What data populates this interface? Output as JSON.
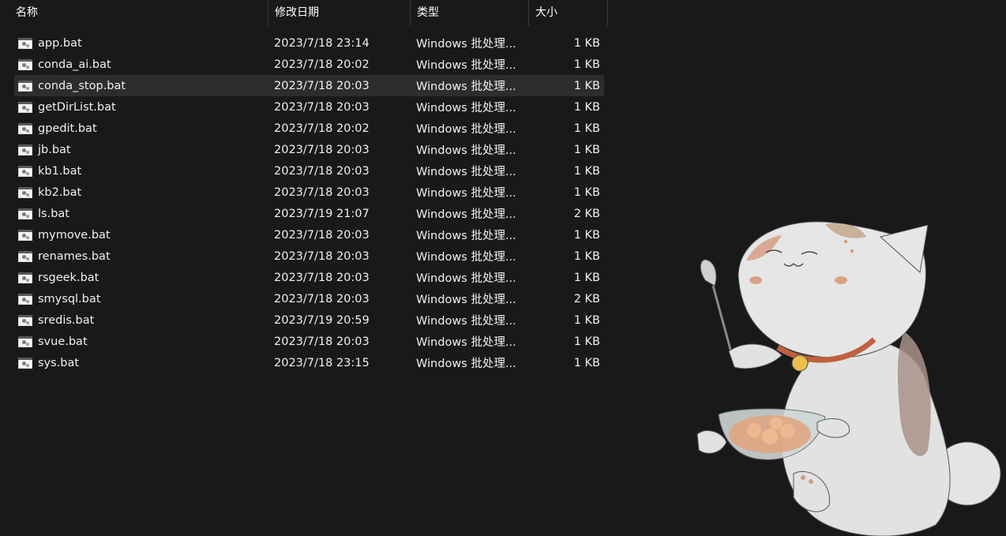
{
  "columns": {
    "name": "名称",
    "date": "修改日期",
    "type": "类型",
    "size": "大小"
  },
  "files": [
    {
      "name": "app.bat",
      "date": "2023/7/18 23:14",
      "type": "Windows 批处理...",
      "size": "1 KB"
    },
    {
      "name": "conda_ai.bat",
      "date": "2023/7/18 20:02",
      "type": "Windows 批处理...",
      "size": "1 KB"
    },
    {
      "name": "conda_stop.bat",
      "date": "2023/7/18 20:03",
      "type": "Windows 批处理...",
      "size": "1 KB"
    },
    {
      "name": "getDirList.bat",
      "date": "2023/7/18 20:03",
      "type": "Windows 批处理...",
      "size": "1 KB"
    },
    {
      "name": "gpedit.bat",
      "date": "2023/7/18 20:02",
      "type": "Windows 批处理...",
      "size": "1 KB"
    },
    {
      "name": "jb.bat",
      "date": "2023/7/18 20:03",
      "type": "Windows 批处理...",
      "size": "1 KB"
    },
    {
      "name": "kb1.bat",
      "date": "2023/7/18 20:03",
      "type": "Windows 批处理...",
      "size": "1 KB"
    },
    {
      "name": "kb2.bat",
      "date": "2023/7/18 20:03",
      "type": "Windows 批处理...",
      "size": "1 KB"
    },
    {
      "name": "ls.bat",
      "date": "2023/7/19 21:07",
      "type": "Windows 批处理...",
      "size": "2 KB"
    },
    {
      "name": "mymove.bat",
      "date": "2023/7/18 20:03",
      "type": "Windows 批处理...",
      "size": "1 KB"
    },
    {
      "name": "renames.bat",
      "date": "2023/7/18 20:03",
      "type": "Windows 批处理...",
      "size": "1 KB"
    },
    {
      "name": "rsgeek.bat",
      "date": "2023/7/18 20:03",
      "type": "Windows 批处理...",
      "size": "1 KB"
    },
    {
      "name": "smysql.bat",
      "date": "2023/7/18 20:03",
      "type": "Windows 批处理...",
      "size": "2 KB"
    },
    {
      "name": "sredis.bat",
      "date": "2023/7/19 20:59",
      "type": "Windows 批处理...",
      "size": "1 KB"
    },
    {
      "name": "svue.bat",
      "date": "2023/7/18 20:03",
      "type": "Windows 批处理...",
      "size": "1 KB"
    },
    {
      "name": "sys.bat",
      "date": "2023/7/18 23:15",
      "type": "Windows 批处理...",
      "size": "1 KB"
    }
  ],
  "selected_row": 2,
  "colors": {
    "background": "#191919",
    "selected_row": "#2d2d2d",
    "text": "#f0f0f0",
    "divider": "#3a3a3a"
  },
  "icons": {
    "file": "batch-file-icon",
    "wallpaper": "cat-eating-illustration"
  }
}
